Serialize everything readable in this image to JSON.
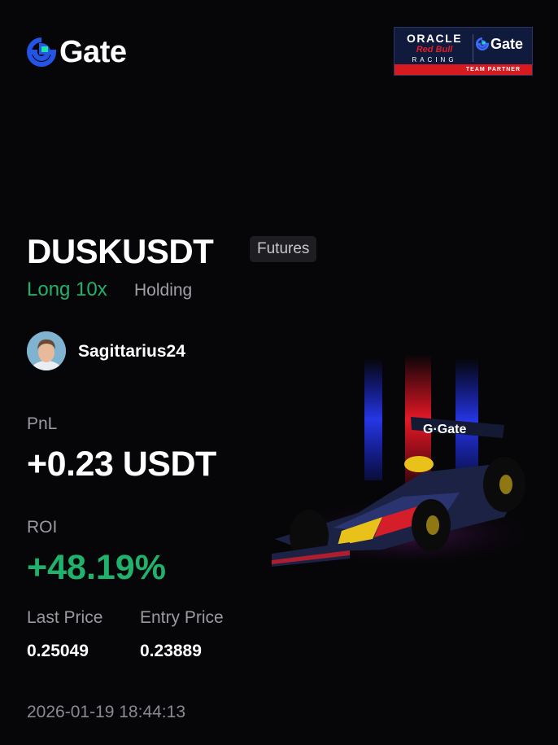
{
  "brand": {
    "name": "Gate",
    "icon": "gate-logo-icon",
    "color": "#2354e6",
    "accent": "#17e5a1"
  },
  "partner": {
    "oracle": "ORACLE",
    "redbull": "Red Bull",
    "racing": "RACING",
    "gate": "Gate",
    "strip": "TEAM PARTNER"
  },
  "position": {
    "pair": "DUSKUSDT",
    "tag": "Futures",
    "direction": "Long 10x",
    "state": "Holding"
  },
  "user": {
    "name": "Sagittarius24",
    "avatar_icon": "avatar-icon"
  },
  "stats": {
    "pnl_label": "PnL",
    "pnl_value": "+0.23 USDT",
    "roi_label": "ROI",
    "roi_value": "+48.19%",
    "last_price_label": "Last Price",
    "last_price_value": "0.25049",
    "entry_price_label": "Entry Price",
    "entry_price_value": "0.23889"
  },
  "timestamp": "2026-01-19 18:44:13",
  "colors": {
    "positive": "#20b26c",
    "background": "#060608",
    "tag_bg": "#1e1e22"
  }
}
